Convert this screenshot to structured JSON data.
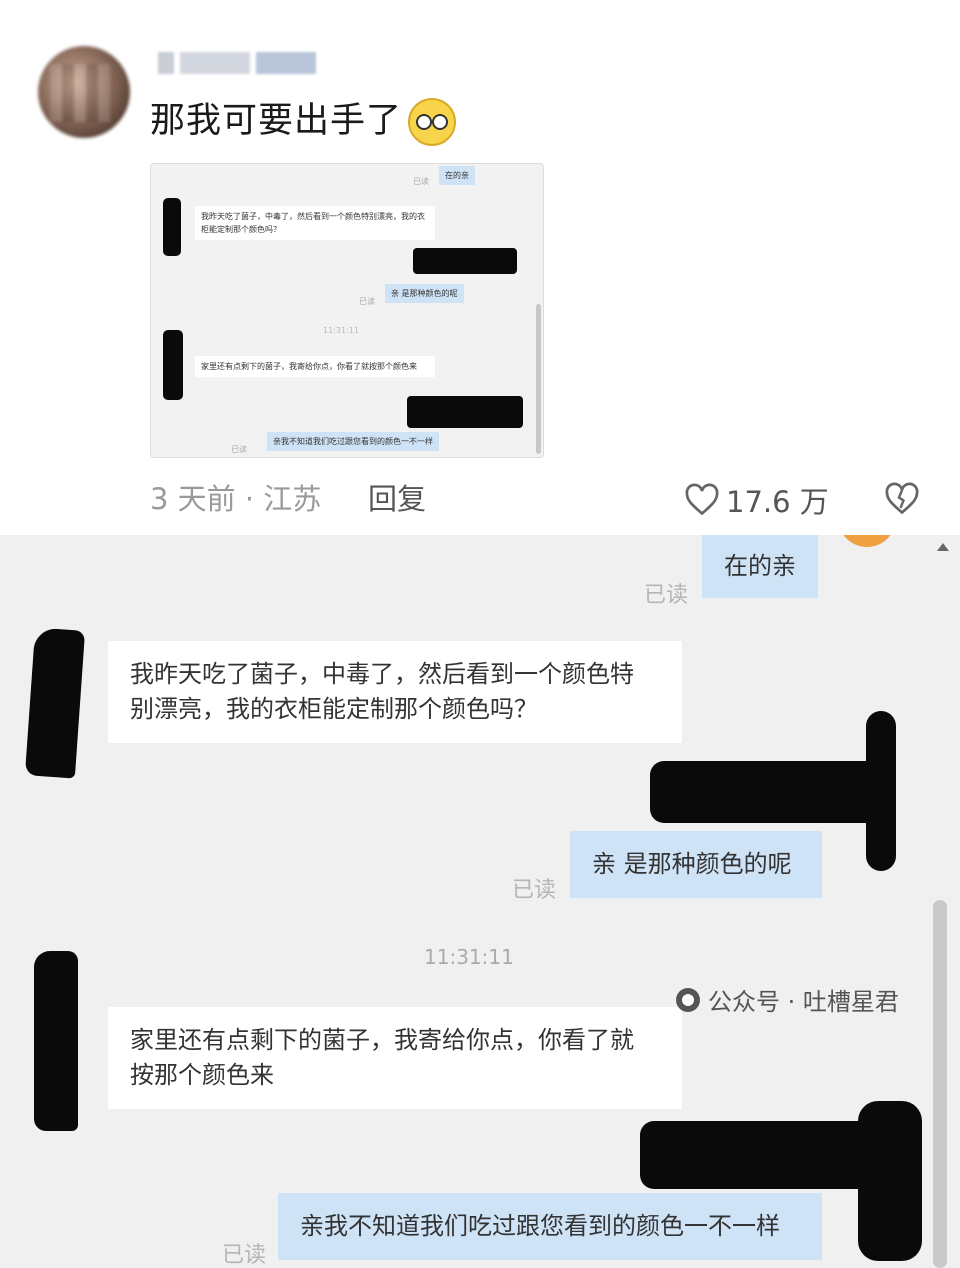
{
  "comment": {
    "text": "那我可要出手了",
    "emoji": "thinking-face-icon",
    "meta": "3 天前 · 江苏",
    "reply_label": "回复",
    "likes": "17.6 万"
  },
  "thumbnail": {
    "msg_top": "在的亲",
    "read1": "已读",
    "msg1": "我昨天吃了菌子，中毒了，然后看到一个颜色特别漂亮，我的衣柜能定制那个颜色吗？",
    "msg2": "亲 是那种颜色的呢",
    "read2": "已读",
    "time": "11:31:11",
    "msg3": "家里还有点剩下的菌子，我寄给你点，你看了就按那个颜色来",
    "msg4": "亲我不知道我们吃过跟您看到的颜色一不一样",
    "read3": "已读"
  },
  "chat": {
    "msg_top": "在的亲",
    "read1": "已读",
    "msg1_line1": "我昨天吃了菌子，中毒了，然后看到一个颜色特",
    "msg1_line2": "别漂亮，我的衣柜能定制那个颜色吗？",
    "msg2": "亲 是那种颜色的呢",
    "read2": "已读",
    "time": "11:31:11",
    "msg3_line1": "家里还有点剩下的菌子，我寄给你点，你看了就",
    "msg3_line2": "按那个颜色来",
    "msg4": "亲我不知道我们吃过跟您看到的颜色一不一样",
    "read3": "已读"
  },
  "watermark": {
    "text": "公众号 · 吐槽星君"
  },
  "colors": {
    "blue_bubble": "#cfe3f7",
    "chat_bg": "#f0f0f0",
    "orange": "#f0a040"
  }
}
